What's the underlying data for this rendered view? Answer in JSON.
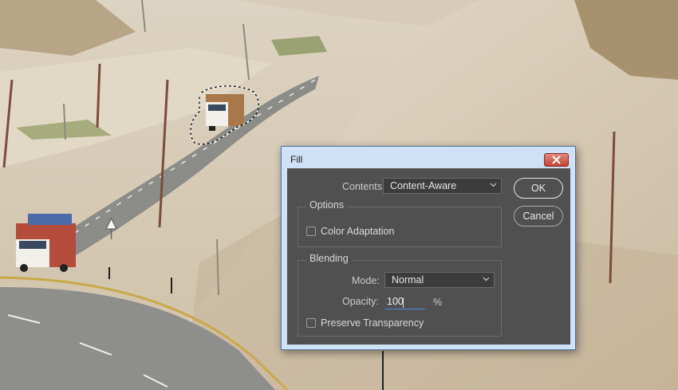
{
  "dialog": {
    "title": "Fill",
    "contents_label": "Contents:",
    "contents_value": "Content-Aware",
    "options_group": "Options",
    "color_adaptation_label": "Color Adaptation",
    "color_adaptation_checked": false,
    "blending_group": "Blending",
    "mode_label": "Mode:",
    "mode_value": "Normal",
    "opacity_label": "Opacity:",
    "opacity_value": "100",
    "opacity_unit": "%",
    "preserve_transparency_label": "Preserve Transparency",
    "preserve_transparency_checked": false,
    "ok_label": "OK",
    "cancel_label": "Cancel"
  },
  "icons": {
    "close": "close-icon",
    "dropdown": "chevron-down-icon"
  },
  "colors": {
    "panel": "#505050",
    "titlebar": "#cfe1f6",
    "close_button": "#c4432f",
    "focus_underline": "#4a8ee6"
  }
}
